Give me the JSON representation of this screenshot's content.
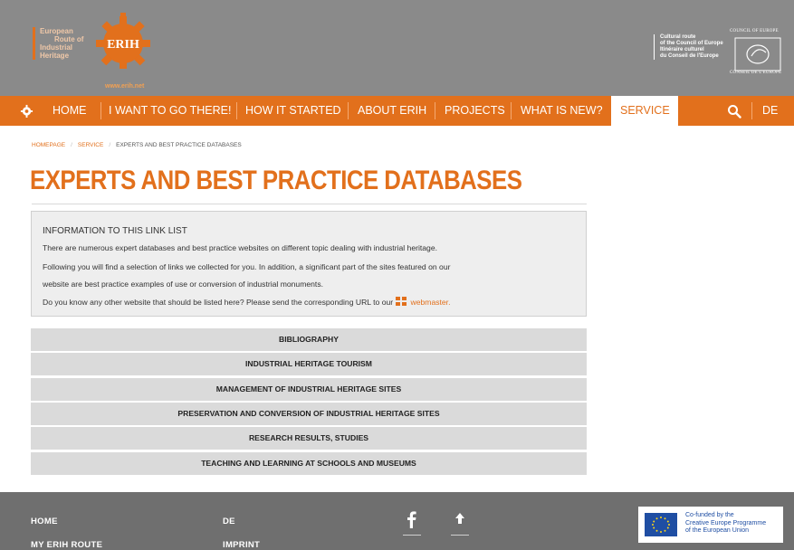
{
  "header": {
    "logo_lines": [
      "European",
      "Route of",
      "Industrial",
      "Heritage"
    ],
    "logo_gear_text": "ERIH",
    "logo_url": "www.erih.net",
    "coe_lines": [
      "Cultural route",
      "of the Council of Europe",
      "Itinéraire culturel",
      "du Conseil de l'Europe"
    ],
    "coe_top": "COUNCIL OF EUROPE",
    "coe_bottom": "CONSEIL DE L'EUROPE"
  },
  "nav": {
    "items": [
      {
        "label": "HOME"
      },
      {
        "label": "I WANT TO GO THERE!"
      },
      {
        "label": "HOW IT STARTED"
      },
      {
        "label": "ABOUT ERIH"
      },
      {
        "label": "PROJECTS"
      },
      {
        "label": "WHAT IS NEW?"
      },
      {
        "label": "SERVICE",
        "active": true
      }
    ],
    "search_icon": "search-icon",
    "language": "DE",
    "accent_color": "#e2701c"
  },
  "breadcrumb": {
    "items": [
      "HOMEPAGE",
      "SERVICE",
      "EXPERTS AND BEST PRACTICE DATABASES"
    ]
  },
  "page": {
    "title": "EXPERTS AND BEST PRACTICE DATABASES"
  },
  "info": {
    "heading": "INFORMATION TO THIS LINK LIST",
    "lines": [
      "There are numerous expert databases and best practice websites on different topic dealing with industrial heritage.",
      "Following you will find a selection of links we collected for you. In addition, a significant part of the sites featured on our",
      "website are best practice examples of use or conversion of industrial monuments.",
      "Do you know any other website that should be listed here? Please send the corresponding URL to our"
    ],
    "webmaster_link": "webmaster",
    "after_link": "."
  },
  "sections": [
    "BIBLIOGRAPHY",
    "INDUSTRIAL HERITAGE TOURISM",
    "MANAGEMENT OF INDUSTRIAL HERITAGE SITES",
    "PRESERVATION AND CONVERSION OF INDUSTRIAL HERITAGE SITES",
    "RESEARCH RESULTS, STUDIES",
    "TEACHING AND LEARNING AT SCHOOLS AND MUSEUMS"
  ],
  "footer": {
    "links_col1": [
      "HOME",
      "MY ERIH ROUTE"
    ],
    "links_col2": [
      "DE",
      "IMPRINT"
    ],
    "icons": [
      "facebook-icon",
      "arrow-up-icon"
    ],
    "eu_text": [
      "Co-funded by the",
      "Creative Europe Programme",
      "of the European Union"
    ]
  }
}
